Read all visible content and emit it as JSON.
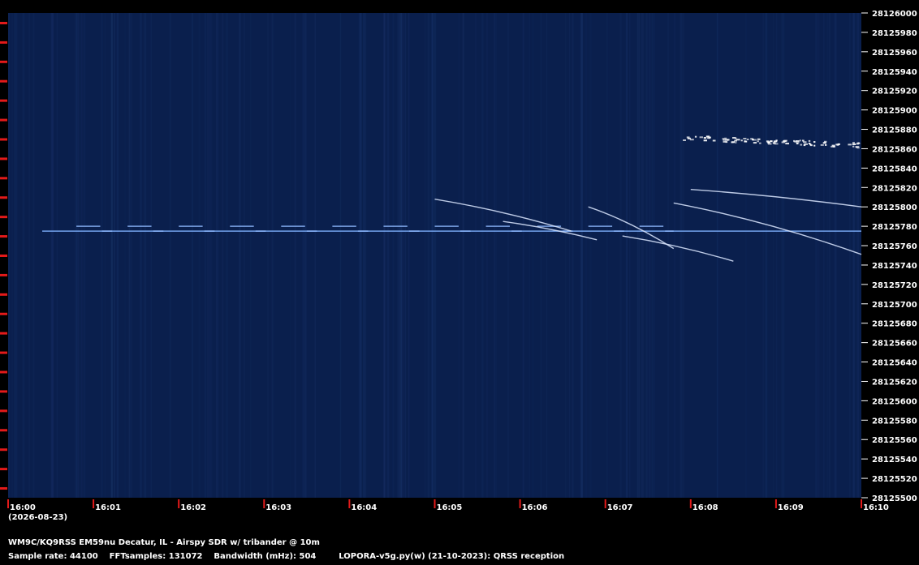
{
  "chart_data": {
    "type": "heatmap",
    "title": "",
    "xlabel": "",
    "ylabel": "",
    "x_ticks": [
      "16:00",
      "16:01",
      "16:02",
      "16:03",
      "16:04",
      "16:05",
      "16:06",
      "16:07",
      "16:08",
      "16:09",
      "16:10"
    ],
    "x_sub_label": "(2026-08-23)",
    "xlim_minutes": [
      0,
      10
    ],
    "y_ticks": [
      28126000,
      28125980,
      28125960,
      28125940,
      28125920,
      28125900,
      28125880,
      28125860,
      28125840,
      28125820,
      28125800,
      28125780,
      28125760,
      28125740,
      28125720,
      28125700,
      28125680,
      28125660,
      28125640,
      28125620,
      28125600,
      28125580,
      28125560,
      28125540,
      28125520,
      28125500
    ],
    "ylim": [
      28125500,
      28126000
    ],
    "grid": false,
    "colors": {
      "background": "#0a1f4d",
      "trace": "#dce8ff",
      "tick": "#e31a1a",
      "text": "#ffffff"
    },
    "signals": [
      {
        "kind": "steady-carrier",
        "t": [
          0.4,
          10
        ],
        "f": 28125775
      },
      {
        "kind": "fsk-steps",
        "t": [
          0.8,
          7.8
        ],
        "f": [
          28125775,
          28125780
        ]
      },
      {
        "kind": "drifting-trace",
        "t": [
          5.0,
          6.6
        ],
        "f": [
          28125808,
          28125775
        ]
      },
      {
        "kind": "drifting-trace",
        "t": [
          5.8,
          6.9
        ],
        "f": [
          28125785,
          28125766
        ]
      },
      {
        "kind": "drifting-trace",
        "t": [
          6.8,
          7.8
        ],
        "f": [
          28125800,
          28125757
        ]
      },
      {
        "kind": "drifting-trace",
        "t": [
          7.2,
          8.5
        ],
        "f": [
          28125770,
          28125744
        ]
      },
      {
        "kind": "drifting-trace",
        "t": [
          7.8,
          10
        ],
        "f": [
          28125804,
          28125751
        ]
      },
      {
        "kind": "drifting-trace",
        "t": [
          8.0,
          10
        ],
        "f": [
          28125818,
          28125800
        ]
      },
      {
        "kind": "bright-blob",
        "t": [
          7.9,
          10
        ],
        "f": [
          28125872,
          28125864
        ]
      }
    ]
  },
  "footer": {
    "line1": "WM9C/KQ9RSS EM59nu Decatur, IL - Airspy SDR w/ tribander @ 10m",
    "line2": "Sample rate: 44100    FFTsamples: 131072    Bandwidth (mHz): 504        LOPORA-v5g.py(w) (21-10-2023): QRSS reception"
  }
}
